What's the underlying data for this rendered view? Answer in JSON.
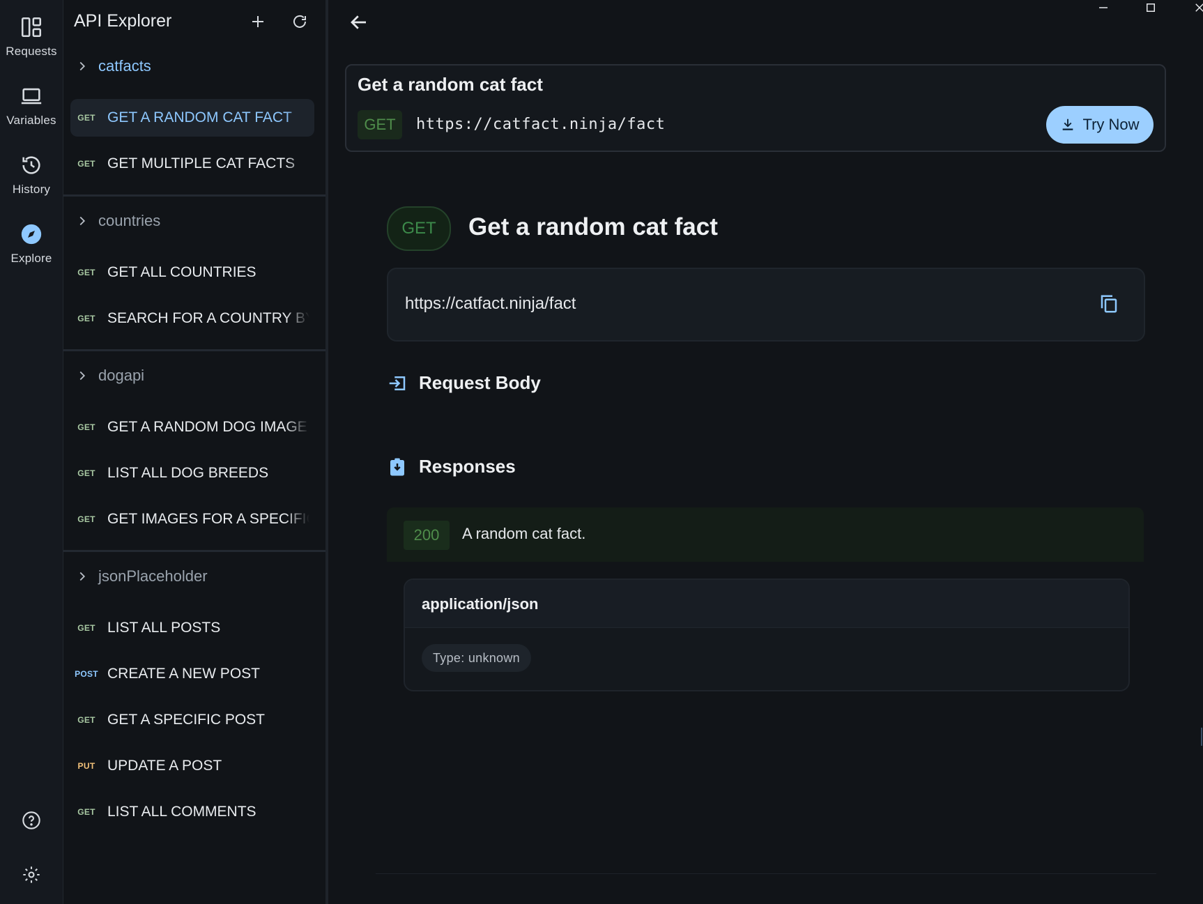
{
  "rail": {
    "items": [
      {
        "label": "Requests",
        "icon": "requests-icon"
      },
      {
        "label": "Variables",
        "icon": "laptop-icon"
      },
      {
        "label": "History",
        "icon": "history-icon"
      },
      {
        "label": "Explore",
        "icon": "compass-icon",
        "active": true
      }
    ],
    "bottom": [
      "help-icon",
      "settings-icon"
    ]
  },
  "explorer": {
    "title": "API Explorer",
    "groups": [
      {
        "name": "catfacts",
        "active": true,
        "requests": [
          {
            "method": "GET",
            "name": "GET A RANDOM CAT FACT",
            "selected": true
          },
          {
            "method": "GET",
            "name": "GET MULTIPLE CAT FACTS"
          }
        ]
      },
      {
        "name": "countries",
        "requests": [
          {
            "method": "GET",
            "name": "GET ALL COUNTRIES"
          },
          {
            "method": "GET",
            "name": "SEARCH FOR A COUNTRY BY"
          }
        ]
      },
      {
        "name": "dogapi",
        "requests": [
          {
            "method": "GET",
            "name": "GET A RANDOM DOG IMAGE"
          },
          {
            "method": "GET",
            "name": "LIST ALL DOG BREEDS"
          },
          {
            "method": "GET",
            "name": "GET IMAGES FOR A SPECIFIC"
          }
        ]
      },
      {
        "name": "jsonPlaceholder",
        "requests": [
          {
            "method": "GET",
            "name": "LIST ALL POSTS"
          },
          {
            "method": "POST",
            "name": "CREATE A NEW POST"
          },
          {
            "method": "GET",
            "name": "GET A SPECIFIC POST"
          },
          {
            "method": "PUT",
            "name": "UPDATE A POST"
          },
          {
            "method": "GET",
            "name": "LIST ALL COMMENTS"
          }
        ]
      }
    ]
  },
  "request_card": {
    "title": "Get a random cat fact",
    "method": "GET",
    "url": "https://catfact.ninja/fact",
    "try_label": "Try Now"
  },
  "detail": {
    "method": "GET",
    "title": "Get a random cat fact",
    "url": "https://catfact.ninja/fact",
    "request_body_label": "Request Body",
    "responses_label": "Responses",
    "response": {
      "code": "200",
      "description": "A random cat fact.",
      "media_type": "application/json",
      "type_label": "Type: unknown"
    }
  },
  "colors": {
    "accent": "#9ccfff",
    "active_link": "#8ec8ff",
    "get_green": "#4f8d4b",
    "background": "#111418"
  }
}
